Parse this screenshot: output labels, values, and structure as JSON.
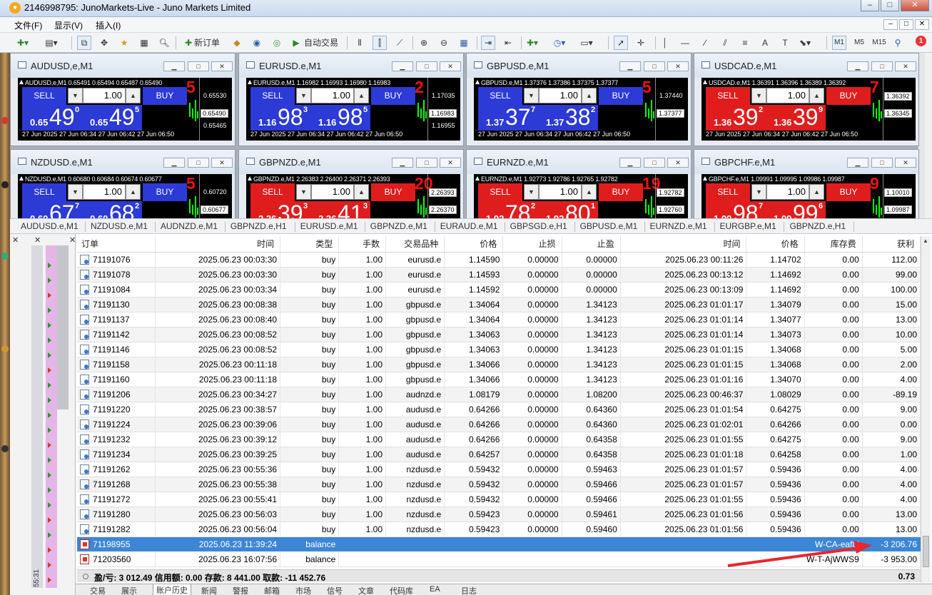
{
  "window": {
    "title": "2146998795: JunoMarkets-Live - Juno Markets Limited",
    "icon": "mt4-terminal-icon"
  },
  "menu": {
    "items": [
      "文件(F)",
      "显示(V)",
      "插入(I)"
    ]
  },
  "toolbar": {
    "new_order": "新订单",
    "auto_trading": "自动交易",
    "timeframes": [
      "M1",
      "M5",
      "M15"
    ],
    "text_tool": "A",
    "notification_count": "1"
  },
  "charts": [
    {
      "title": "AUDUSD,e,M1",
      "symbol_line": "AUDUSD,e,M1  0.65491 0.65494 0.65487 0.65490",
      "spread": "5",
      "lot": "1.00",
      "sell_label": "SELL",
      "buy_label": "BUY",
      "sell_small": "0.65",
      "sell_big": "49",
      "sell_sup": "0",
      "buy_small": "0.65",
      "buy_big": "49",
      "buy_sup": "5",
      "scale": [
        "0.65530",
        "0.65490",
        "0.65465"
      ],
      "dates": "27 Jun 2025    27 Jun 06:34    27 Jun 06:42    27 Jun 06:50",
      "color": "blue"
    },
    {
      "title": "EURUSD.e,M1",
      "symbol_line": "EURUSD.e,M1  1.16982 1.16993 1.16980 1.16983",
      "spread": "2",
      "lot": "1.00",
      "sell_label": "SELL",
      "buy_label": "BUY",
      "sell_small": "1.16",
      "sell_big": "98",
      "sell_sup": "3",
      "buy_small": "1.16",
      "buy_big": "98",
      "buy_sup": "5",
      "scale": [
        "1.17035",
        "1.16983",
        "1.16955"
      ],
      "dates": "27 Jun 2025    27 Jun 06:34    27 Jun 06:42    27 Jun 06:50",
      "color": "blue"
    },
    {
      "title": "GBPUSD.e,M1",
      "symbol_line": "GBPUSD.e,M1  1.37376 1.37386 1.37375 1.37377",
      "spread": "5",
      "lot": "1.00",
      "sell_label": "SELL",
      "buy_label": "BUY",
      "sell_small": "1.37",
      "sell_big": "37",
      "sell_sup": "7",
      "buy_small": "1.37",
      "buy_big": "38",
      "buy_sup": "2",
      "scale": [
        "1.37440",
        "1.37377",
        ""
      ],
      "dates": "27 Jun 2025    27 Jun 06:34    27 Jun 06:42    27 Jun 06:50",
      "color": "blue"
    },
    {
      "title": "USDCAD.e,M1",
      "symbol_line": "USDCAD.e,M1  1.36391 1.36396 1.36389 1.36392",
      "spread": "7",
      "lot": "1.00",
      "sell_label": "SELL",
      "buy_label": "BUY",
      "sell_small": "1.36",
      "sell_big": "39",
      "sell_sup": "2",
      "buy_small": "1.36",
      "buy_big": "39",
      "buy_sup": "9",
      "scale": [
        "1.36392",
        "1.36345",
        ""
      ],
      "dates": "27 Jun 2025    27 Jun 06:34    27 Jun 06:42    27 Jun 06:50",
      "color": "red"
    },
    {
      "title": "NZDUSD.e,M1",
      "symbol_line": "NZDUSD.e,M1  0.60680 0.60684 0.60674 0.60677",
      "spread": "5",
      "lot": "1.00",
      "sell_label": "SELL",
      "buy_label": "BUY",
      "sell_small": "0.60",
      "sell_big": "67",
      "sell_sup": "7",
      "buy_small": "0.60",
      "buy_big": "68",
      "buy_sup": "2",
      "scale": [
        "0.60720",
        "0.60677",
        ""
      ],
      "dates": "",
      "color": "blue"
    },
    {
      "title": "GBPNZD.e,M1",
      "symbol_line": "GBPNZD.e,M1  2.26383 2.26400 2.26371 2.26393",
      "spread": "20",
      "lot": "1.00",
      "sell_label": "SELL",
      "buy_label": "BUY",
      "sell_small": "2.26",
      "sell_big": "39",
      "sell_sup": "3",
      "buy_small": "2.26",
      "buy_big": "41",
      "buy_sup": "3",
      "scale": [
        "2.26393",
        "2.26370",
        ""
      ],
      "dates": "",
      "color": "red"
    },
    {
      "title": "EURNZD.e,M1",
      "symbol_line": "EURNZD.e,M1  1.92773 1.92786 1.92765 1.92782",
      "spread": "19",
      "lot": "1.00",
      "sell_label": "SELL",
      "buy_label": "BUY",
      "sell_small": "1.92",
      "sell_big": "78",
      "sell_sup": "2",
      "buy_small": "1.92",
      "buy_big": "80",
      "buy_sup": "1",
      "scale": [
        "1.92782",
        "1.92760",
        ""
      ],
      "dates": "",
      "color": "red"
    },
    {
      "title": "GBPCHF.e,M1",
      "symbol_line": "GBPCHF.e,M1  1.09991 1.09995 1.09986 1.09987",
      "spread": "9",
      "lot": "1.00",
      "sell_label": "SELL",
      "buy_label": "BUY",
      "sell_small": "1.09",
      "sell_big": "98",
      "sell_sup": "7",
      "buy_small": "1.09",
      "buy_big": "99",
      "buy_sup": "6",
      "scale": [
        "1.10010",
        "1.09987",
        ""
      ],
      "dates": "",
      "color": "red"
    }
  ],
  "chart_tabs": [
    "AUDUSD.e,M1",
    "NZDUSD.e,M1",
    "AUDNZD.e,M1",
    "GBPNZD.e,H1",
    "EURUSD.e,M1",
    "GBPNZD.e,M1",
    "EURAUD.e,M1",
    "GBPSGD.e,H1",
    "GBPUSD.e,M1",
    "EURNZD.e,M1",
    "EURGBP.e,M1",
    "GBPNZD.e,H1"
  ],
  "history": {
    "columns": [
      "订单",
      "时间",
      "类型",
      "手数",
      "交易品种",
      "价格",
      "止损",
      "止盈",
      "时间",
      "价格",
      "库存费",
      "获利"
    ],
    "rows": [
      [
        "71191076",
        "2025.06.23 00:03:30",
        "buy",
        "1.00",
        "eurusd.e",
        "1.14590",
        "0.00000",
        "0.00000",
        "2025.06.23 00:11:26",
        "1.14702",
        "0.00",
        "112.00"
      ],
      [
        "71191078",
        "2025.06.23 00:03:30",
        "buy",
        "1.00",
        "eurusd.e",
        "1.14593",
        "0.00000",
        "0.00000",
        "2025.06.23 00:13:12",
        "1.14692",
        "0.00",
        "99.00"
      ],
      [
        "71191084",
        "2025.06.23 00:03:34",
        "buy",
        "1.00",
        "eurusd.e",
        "1.14592",
        "0.00000",
        "0.00000",
        "2025.06.23 00:13:09",
        "1.14692",
        "0.00",
        "100.00"
      ],
      [
        "71191130",
        "2025.06.23 00:08:38",
        "buy",
        "1.00",
        "gbpusd.e",
        "1.34064",
        "0.00000",
        "1.34123",
        "2025.06.23 01:01:17",
        "1.34079",
        "0.00",
        "15.00"
      ],
      [
        "71191137",
        "2025.06.23 00:08:40",
        "buy",
        "1.00",
        "gbpusd.e",
        "1.34064",
        "0.00000",
        "1.34123",
        "2025.06.23 01:01:14",
        "1.34077",
        "0.00",
        "13.00"
      ],
      [
        "71191142",
        "2025.06.23 00:08:52",
        "buy",
        "1.00",
        "gbpusd.e",
        "1.34063",
        "0.00000",
        "1.34123",
        "2025.06.23 01:01:14",
        "1.34073",
        "0.00",
        "10.00"
      ],
      [
        "71191146",
        "2025.06.23 00:08:52",
        "buy",
        "1.00",
        "gbpusd.e",
        "1.34063",
        "0.00000",
        "1.34123",
        "2025.06.23 01:01:15",
        "1.34068",
        "0.00",
        "5.00"
      ],
      [
        "71191158",
        "2025.06.23 00:11:18",
        "buy",
        "1.00",
        "gbpusd.e",
        "1.34066",
        "0.00000",
        "1.34123",
        "2025.06.23 01:01:15",
        "1.34068",
        "0.00",
        "2.00"
      ],
      [
        "71191160",
        "2025.06.23 00:11:18",
        "buy",
        "1.00",
        "gbpusd.e",
        "1.34066",
        "0.00000",
        "1.34123",
        "2025.06.23 01:01:16",
        "1.34070",
        "0.00",
        "4.00"
      ],
      [
        "71191206",
        "2025.06.23 00:34:27",
        "buy",
        "1.00",
        "audnzd.e",
        "1.08179",
        "0.00000",
        "1.08200",
        "2025.06.23 00:46:37",
        "1.08029",
        "0.00",
        "-89.19"
      ],
      [
        "71191220",
        "2025.06.23 00:38:57",
        "buy",
        "1.00",
        "audusd.e",
        "0.64266",
        "0.00000",
        "0.64360",
        "2025.06.23 01:01:54",
        "0.64275",
        "0.00",
        "9.00"
      ],
      [
        "71191224",
        "2025.06.23 00:39:06",
        "buy",
        "1.00",
        "audusd.e",
        "0.64266",
        "0.00000",
        "0.64360",
        "2025.06.23 01:02:01",
        "0.64266",
        "0.00",
        "0.00"
      ],
      [
        "71191232",
        "2025.06.23 00:39:12",
        "buy",
        "1.00",
        "audusd.e",
        "0.64266",
        "0.00000",
        "0.64358",
        "2025.06.23 01:01:55",
        "0.64275",
        "0.00",
        "9.00"
      ],
      [
        "71191234",
        "2025.06.23 00:39:25",
        "buy",
        "1.00",
        "audusd.e",
        "0.64257",
        "0.00000",
        "0.64358",
        "2025.06.23 01:01:18",
        "0.64258",
        "0.00",
        "1.00"
      ],
      [
        "71191262",
        "2025.06.23 00:55:36",
        "buy",
        "1.00",
        "nzdusd.e",
        "0.59432",
        "0.00000",
        "0.59463",
        "2025.06.23 01:01:57",
        "0.59436",
        "0.00",
        "4.00"
      ],
      [
        "71191268",
        "2025.06.23 00:55:38",
        "buy",
        "1.00",
        "nzdusd.e",
        "0.59432",
        "0.00000",
        "0.59466",
        "2025.06.23 01:01:57",
        "0.59436",
        "0.00",
        "4.00"
      ],
      [
        "71191272",
        "2025.06.23 00:55:41",
        "buy",
        "1.00",
        "nzdusd.e",
        "0.59432",
        "0.00000",
        "0.59466",
        "2025.06.23 01:01:55",
        "0.59436",
        "0.00",
        "4.00"
      ],
      [
        "71191280",
        "2025.06.23 00:56:03",
        "buy",
        "1.00",
        "nzdusd.e",
        "0.59423",
        "0.00000",
        "0.59461",
        "2025.06.23 01:01:56",
        "0.59436",
        "0.00",
        "13.00"
      ],
      [
        "71191282",
        "2025.06.23 00:56:04",
        "buy",
        "1.00",
        "nzdusd.e",
        "0.59423",
        "0.00000",
        "0.59460",
        "2025.06.23 01:01:56",
        "0.59436",
        "0.00",
        "13.00"
      ]
    ],
    "balance_rows": [
      {
        "ticket": "71198955",
        "time": "2025.06.23 11:39:24",
        "type": "balance",
        "comment": "W-CA-eaf8l",
        "profit": "-3 206.76",
        "highlighted": true
      },
      {
        "ticket": "71203560",
        "time": "2025.06.23 16:07:56",
        "type": "balance",
        "comment": "W-T-AjWWS9",
        "profit": "-3 953.00",
        "highlighted": false
      }
    ],
    "summary": "盈/亏: 3 012.49  信用额: 0.00  存款: 8 441.00  取款: -11 452.76",
    "summary_total": "0.73"
  },
  "side_time": "55:31",
  "bottom_tabs": [
    "交易",
    "展示",
    "账户历史",
    "新闻",
    "警报",
    "邮箱",
    "市场",
    "信号",
    "文章",
    "代码库",
    "EA",
    "日志"
  ],
  "colors": {
    "sell_blue": "#2c3ad6",
    "sell_red": "#e01d1d",
    "highlight_row": "#3d86d6",
    "annotation_arrow": "#e8262e"
  }
}
